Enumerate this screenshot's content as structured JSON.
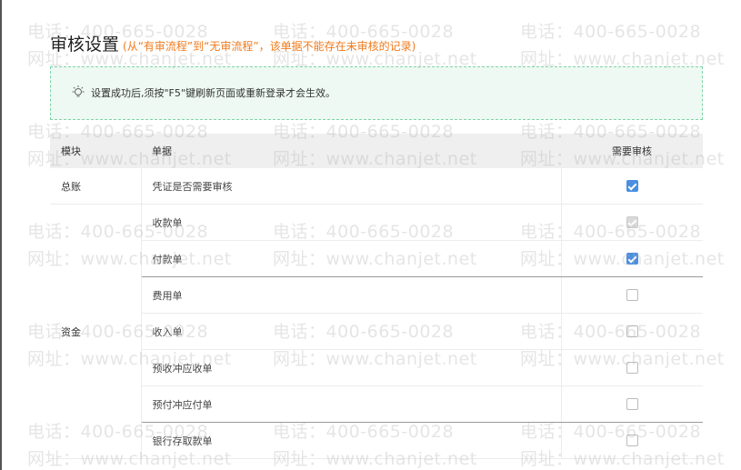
{
  "header": {
    "title": "审核设置",
    "subtitle": "(从“有审流程”到“无审流程”，该单据不能存在未审核的记录)"
  },
  "notice": {
    "text": "设置成功后,须按\"F5\"键刷新页面或重新登录才会生效。",
    "icon": "lightbulb-icon"
  },
  "table": {
    "headers": {
      "module": "模块",
      "document": "单据",
      "needs_review": "需要审核"
    },
    "rows": [
      {
        "module": "总账",
        "doc": "凭证是否需要审核",
        "state": "checked"
      },
      {
        "module": "",
        "doc": "收款单",
        "state": "checked-disabled"
      },
      {
        "module": "",
        "doc": "付款单",
        "state": "checked"
      },
      {
        "module": "",
        "doc": "费用单",
        "state": "unchecked"
      },
      {
        "module": "",
        "doc": "收入单",
        "state": "unchecked"
      },
      {
        "module": "资金",
        "doc": "预收冲应收单",
        "state": "unchecked"
      },
      {
        "module": "",
        "doc": "预付冲应付单",
        "state": "unchecked"
      },
      {
        "module": "",
        "doc": "银行存取款单",
        "state": "unchecked"
      }
    ]
  },
  "watermark": {
    "phone": "电话：400-665-0028",
    "site": "网址：www.chanjet.net"
  },
  "colors": {
    "accent": "#4a8fe0",
    "subtitle": "#f07a1c",
    "notice_bg": "#eef9f3",
    "notice_border": "#7fd3a8"
  }
}
